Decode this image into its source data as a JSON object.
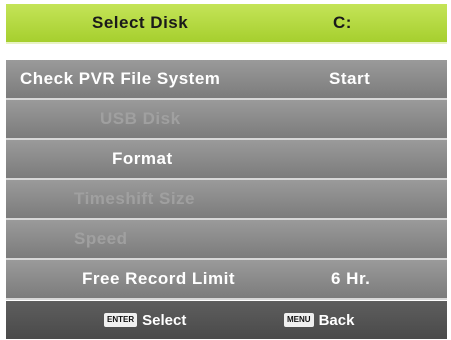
{
  "menu": {
    "rows": [
      {
        "label": "Select Disk",
        "value": "C:",
        "state": "selected"
      },
      {
        "label": "Check PVR File System",
        "value": "Start",
        "state": "normal"
      },
      {
        "label": "USB Disk",
        "value": "",
        "state": "disabled"
      },
      {
        "label": "Format",
        "value": "",
        "state": "normal"
      },
      {
        "label": "Timeshift Size",
        "value": "",
        "state": "disabled"
      },
      {
        "label": "Speed",
        "value": "",
        "state": "disabled"
      },
      {
        "label": "Free Record Limit",
        "value": "6 Hr.",
        "state": "normal"
      }
    ]
  },
  "footer": {
    "select_key": "ENTER",
    "select_label": "Select",
    "back_key": "MENU",
    "back_label": "Back"
  },
  "colors": {
    "selected_row": "#b5db42",
    "row": "#8a8a8a",
    "disabled_text": "#a0a0a0",
    "footer": "#545454"
  }
}
